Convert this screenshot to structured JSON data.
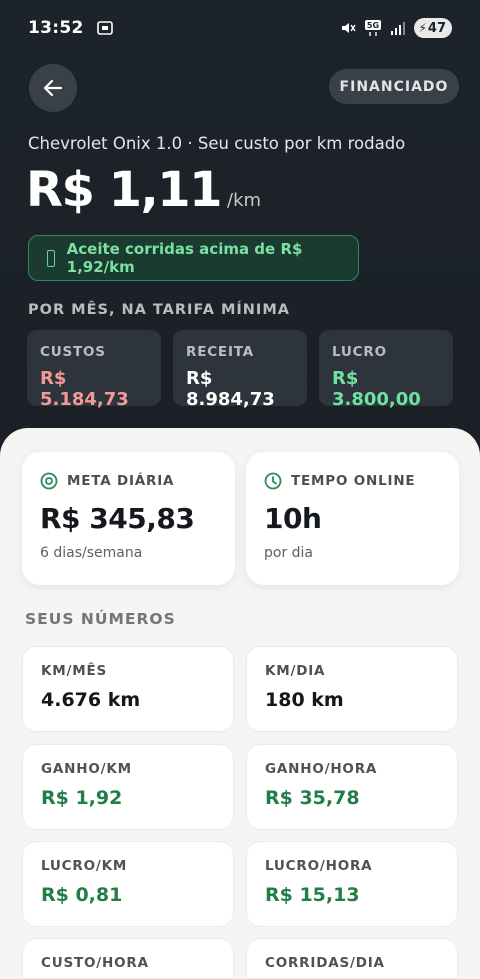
{
  "status_bar": {
    "time": "13:52",
    "battery": "47",
    "network": "5G",
    "icons": [
      "cast-icon",
      "mute-icon",
      "signal-icon",
      "battery-icon"
    ]
  },
  "nav": {
    "back_icon": "arrow-left-icon",
    "badge": "FINANCIADO"
  },
  "header": {
    "subtitle": "Chevrolet Onix 1.0 · Seu custo por km rodado",
    "price": "R$ 1,11",
    "unit": "/km",
    "accept_text": "Aceite corridas acima de R$ 1,92/km"
  },
  "monthly": {
    "label": "POR MÊS, NA TARIFA MÍNIMA",
    "cards": [
      {
        "label": "CUSTOS",
        "value": "R$ 5.184,73",
        "color": "#f39a98"
      },
      {
        "label": "RECEITA",
        "value": "R$ 8.984,73",
        "color": "#ffffff"
      },
      {
        "label": "LUCRO",
        "value": "R$ 3.800,00",
        "color": "#6fe3a0"
      }
    ]
  },
  "goals": {
    "meta": {
      "label": "META DIÁRIA",
      "value": "R$ 345,83",
      "note": "6 dias/semana",
      "icon": "target-icon"
    },
    "tempo": {
      "label": "TEMPO ONLINE",
      "value": "10h",
      "note": "por dia",
      "icon": "clock-icon"
    }
  },
  "numbers": {
    "label": "SEUS NÚMEROS",
    "items": [
      {
        "label": "KM/MÊS",
        "value": "4.676 km"
      },
      {
        "label": "KM/DIA",
        "value": "180 km"
      },
      {
        "label": "GANHO/KM",
        "value": "R$ 1,92"
      },
      {
        "label": "GANHO/HORA",
        "value": "R$ 35,78"
      },
      {
        "label": "LUCRO/KM",
        "value": "R$ 0,81"
      },
      {
        "label": "LUCRO/HORA",
        "value": "R$ 15,13"
      },
      {
        "label": "CUSTO/HORA",
        "value": ""
      },
      {
        "label": "CORRIDAS/DIA",
        "value": ""
      }
    ]
  }
}
